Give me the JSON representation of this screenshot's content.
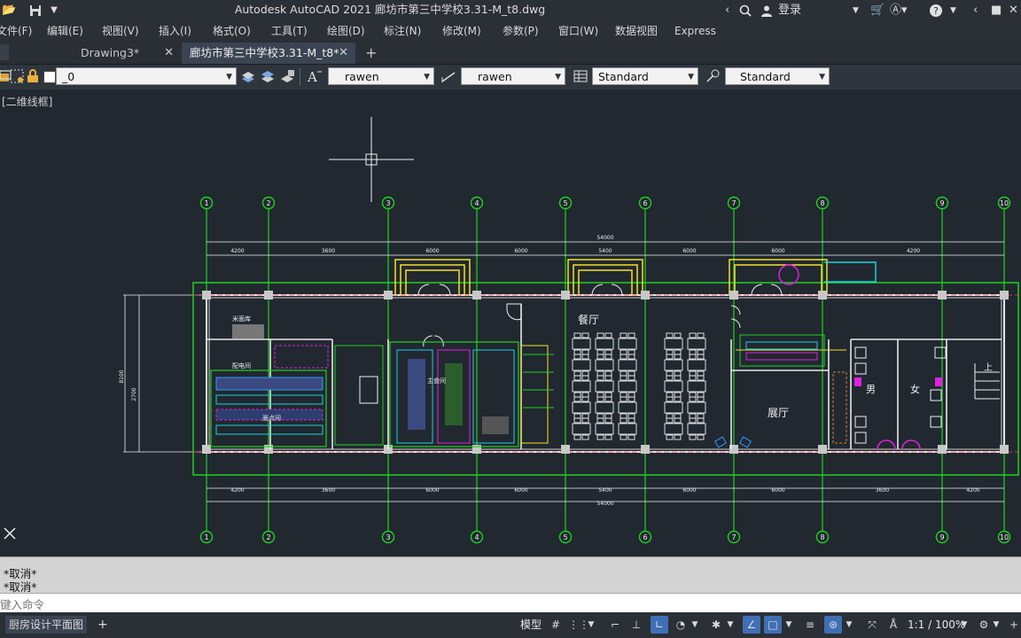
{
  "app": {
    "title": "Autodesk AutoCAD 2021    廊坊市第三中学校3.31-M_t8.dwg",
    "user_label": "登录"
  },
  "menu": {
    "items": [
      "文件(F)",
      "编辑(E)",
      "视图(V)",
      "插入(I)",
      "格式(O)",
      "工具(T)",
      "绘图(D)",
      "标注(N)",
      "修改(M)",
      "参数(P)",
      "窗口(W)",
      "数据视图",
      "Express"
    ]
  },
  "tabs": [
    {
      "label": "Drawing3*",
      "close": "✕"
    },
    {
      "label": "廊坊市第三中学校3.31-M_t8*",
      "close": "✕"
    }
  ],
  "properties": {
    "layer": "_0",
    "text_style": "rawen",
    "dim_style": "rawen",
    "table_style": "Standard",
    "multileader_style": "Standard"
  },
  "viewport": {
    "label": "[二维线框]"
  },
  "drawing": {
    "axis_numbers": [
      "1",
      "2",
      "3",
      "4",
      "5",
      "6",
      "7",
      "8",
      "9",
      "10"
    ],
    "top_dims": [
      "4200",
      "3600",
      "6000",
      "6000",
      "5400",
      "6000",
      "6000",
      "4200"
    ],
    "bottom_dims": [
      "4200",
      "3600",
      "6000",
      "6000",
      "5400",
      "6000",
      "6000",
      "3600",
      "4200"
    ],
    "overall_dim": "54000",
    "left_dims": [
      "8100",
      "2700"
    ],
    "rooms": {
      "dining": "餐厅",
      "hall": "展厅",
      "rice_store": "米面库",
      "elec_room": "配电间",
      "pastry_room": "面点间",
      "main_cooking": "主食间",
      "male": "男",
      "female": "女",
      "stair_up": "上"
    }
  },
  "command": {
    "history": [
      "*取消*",
      "*取消*"
    ],
    "placeholder": "键入命令"
  },
  "status": {
    "layout_tab": "厨房设计平面图",
    "add_tab": "+",
    "model": "模型",
    "scale": "1:1 / 100%"
  }
}
